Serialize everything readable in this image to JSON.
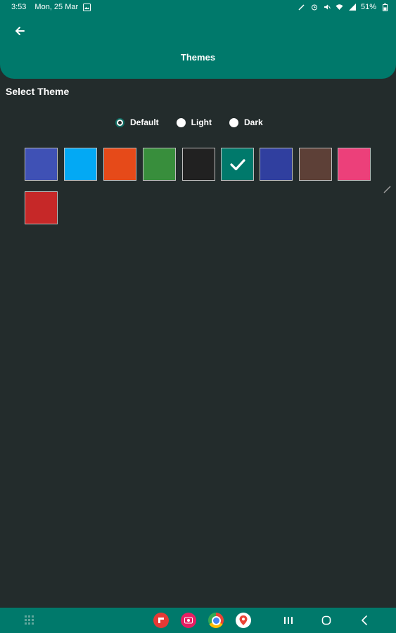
{
  "status": {
    "time": "3:53",
    "date": "Mon, 25 Mar",
    "battery": "51%"
  },
  "appbar": {
    "title": "Themes"
  },
  "section": {
    "title": "Select Theme"
  },
  "modes": [
    {
      "label": "Default",
      "selected": true
    },
    {
      "label": "Light",
      "selected": false
    },
    {
      "label": "Dark",
      "selected": false
    }
  ],
  "swatches": [
    {
      "name": "indigo",
      "color": "#3f51b5",
      "selected": false
    },
    {
      "name": "light-blue",
      "color": "#03a9f4",
      "selected": false
    },
    {
      "name": "deep-orange",
      "color": "#e64a19",
      "selected": false
    },
    {
      "name": "green",
      "color": "#388e3c",
      "selected": false
    },
    {
      "name": "black",
      "color": "#212121",
      "selected": false
    },
    {
      "name": "teal",
      "color": "#00796b",
      "selected": true
    },
    {
      "name": "dark-indigo",
      "color": "#303f9f",
      "selected": false
    },
    {
      "name": "brown",
      "color": "#5d4037",
      "selected": false
    },
    {
      "name": "pink",
      "color": "#ec407a",
      "selected": false
    },
    {
      "name": "red",
      "color": "#c62828",
      "selected": false
    }
  ],
  "navbar": {
    "apps": [
      "apps-grid-icon",
      "flipboard-icon",
      "screen-recorder-icon",
      "chrome-icon",
      "maps-icon"
    ],
    "buttons": [
      "recents-icon",
      "home-icon",
      "back-icon"
    ]
  }
}
